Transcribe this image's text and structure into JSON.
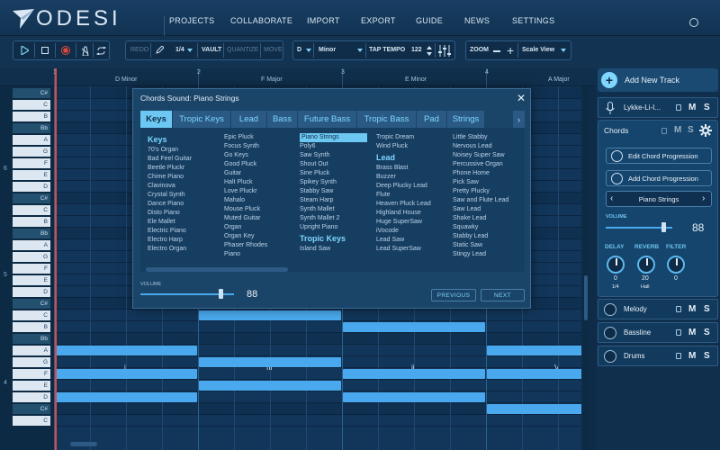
{
  "header": {
    "logo_text": "ODESI",
    "nav": [
      "PROJECTS",
      "COLLABORATE",
      "IMPORT",
      "EXPORT",
      "GUIDE",
      "NEWS",
      "SETTINGS"
    ]
  },
  "toolbar": {
    "redo": "REDO",
    "note_length": "1/4",
    "vault": "VAULT",
    "quantize": "QUANTIZE",
    "move": "MOVE",
    "key": "D",
    "scale": "Minor",
    "tap_tempo": "TAP TEMPO",
    "tempo": "122",
    "zoom": "ZOOM",
    "view": "Scale View"
  },
  "ruler": {
    "bars": [
      "1",
      "2",
      "3",
      "4"
    ],
    "chords": [
      "D Minor",
      "F Major",
      "E Minor",
      "A Major"
    ]
  },
  "piano": {
    "octaves": [
      "6",
      "5",
      "4"
    ],
    "keys": [
      "C#",
      "C",
      "B",
      "Bb",
      "A",
      "G",
      "F",
      "E",
      "D",
      "C#",
      "C",
      "B",
      "Bb",
      "A",
      "G",
      "F",
      "E",
      "D",
      "C#",
      "C",
      "B",
      "Bb",
      "A",
      "G",
      "F",
      "E",
      "D",
      "C#",
      "C"
    ]
  },
  "roman_numerals": [
    "i",
    "III",
    "ii",
    "V"
  ],
  "dialog": {
    "title": "Chords Sound: Piano Strings",
    "tabs": [
      "Keys",
      "Tropic Keys",
      "Lead",
      "Bass",
      "Future Bass",
      "Tropic Bass",
      "Pad",
      "Strings"
    ],
    "columns": [
      {
        "items": [
          {
            "h": "Keys"
          },
          "70's Organ",
          "Bad Feel Guitar",
          "Beetle Pluckr",
          "Chime Piano",
          "Clavinova",
          "Crystal Synth",
          "Dance Piano",
          "Disto Piano",
          "Ele Mallet",
          "Electric Piano",
          "Electro Harp",
          "Electro Organ"
        ]
      },
      {
        "items": [
          "Epic Pluck",
          "Focus Synth",
          "Go Keys",
          "Good Pluck",
          "Guitar",
          "Halt Pluck",
          "Love Pluckr",
          "Mahalo",
          "Mouse Pluck",
          "Muted Guitar",
          "Organ",
          "Organ Key",
          "Phaser Rhodes",
          "Piano"
        ]
      },
      {
        "items": [
          "Piano Strings",
          "Poly6",
          "Saw Synth",
          "Shout Out",
          "Sine Pluck",
          "Spikey Synth",
          "Stabby Saw",
          "Steam Harp",
          "Synth Mallet",
          "Synth Mallet 2",
          "Upright Piano",
          {
            "h": "Tropic Keys"
          },
          "Island Saw"
        ]
      },
      {
        "items": [
          "Tropic Dream",
          "Wind Pluck",
          {
            "h": "Lead"
          },
          "Brass Blast",
          "Buzzer",
          "Deep Plucky Lead",
          "Flute",
          "Heaven Pluck Lead",
          "Highland House",
          "Huge SuperSaw",
          "iVocode",
          "Lead Saw",
          "Lead SuperSaw"
        ]
      },
      {
        "items": [
          "Little Stabby",
          "Nervous Lead",
          "Noisey Super Saw",
          "Percussive Organ",
          "Phone Home",
          "Pick Saw",
          "Pretty Plucky",
          "Saw and Flute Lead",
          "Saw Lead",
          "Shake Lead",
          "Squawky",
          "Stabby Lead",
          "Static Saw",
          "Stingy Lead"
        ]
      }
    ],
    "selected": "Piano Strings",
    "volume_label": "VOLUME",
    "volume": "88",
    "volume_fraction": 0.88,
    "previous": "PREVIOUS",
    "next": "NEXT"
  },
  "panel": {
    "add_track": "Add New Track",
    "vocal_track": "Lykke-Li-I...",
    "chords": "Chords",
    "edit_progression": "Edit Chord Progression",
    "add_progression": "Add Chord Progression",
    "instrument": "Piano Strings",
    "volume_label": "VOLUME",
    "volume": "88",
    "volume_fraction": 0.88,
    "fx": [
      {
        "label": "DELAY",
        "value": "0",
        "sub": "1/4"
      },
      {
        "label": "REVERB",
        "value": "20",
        "sub": "Hall"
      },
      {
        "label": "FILTER",
        "value": "0",
        "sub": ""
      }
    ],
    "tracks": [
      "Melody",
      "Bassline",
      "Drums"
    ],
    "m": "M",
    "s": "S"
  },
  "colors": {
    "background": "#0e2c47",
    "accent": "#6cc8f2",
    "note": "#4aa9ee",
    "playhead": "#e2483d"
  }
}
